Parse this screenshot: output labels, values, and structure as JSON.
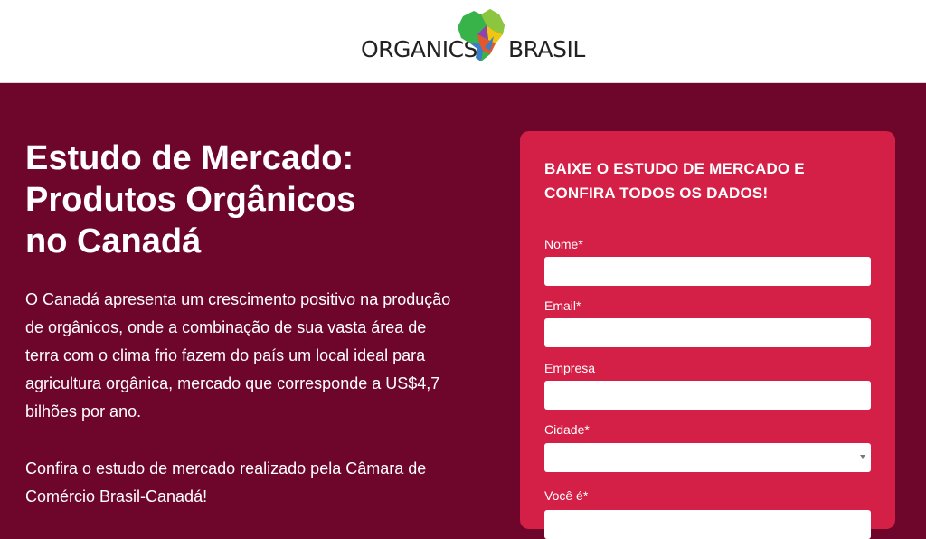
{
  "header": {
    "logo": {
      "word_left": "ORGANICS",
      "word_right": "BRASIL",
      "map_icon": "brazil-map-icon",
      "colors": [
        "#37b34a",
        "#f2c511",
        "#e4572e",
        "#3a7dc9",
        "#8e44ad"
      ]
    }
  },
  "hero": {
    "headline_lines": [
      "Estudo de Mercado:",
      "Produtos Orgânicos",
      "no Canadá"
    ],
    "paragraph_1": "O Canadá apresenta um crescimento positivo na produção de orgânicos, onde a combinação de sua vasta área de terra com o clima frio fazem do país um local ideal para agricultura orgânica, mercado que corresponde a US$4,7 bilhões por ano.",
    "paragraph_2": "Confira o estudo de mercado realizado pela Câmara de Comércio Brasil-Canadá!"
  },
  "form": {
    "title": "BAIXE O ESTUDO DE MERCADO E CONFIRA TODOS OS DADOS!",
    "fields": [
      {
        "label": "Nome*",
        "value": ""
      },
      {
        "label": "Email*",
        "value": ""
      },
      {
        "label": "Empresa",
        "value": ""
      },
      {
        "label": "Cidade*",
        "value": "",
        "type": "select"
      },
      {
        "label": "Você é*",
        "value": ""
      }
    ]
  },
  "colors": {
    "background": "#6e062c",
    "form_card": "#d41f46",
    "header": "#ffffff"
  }
}
